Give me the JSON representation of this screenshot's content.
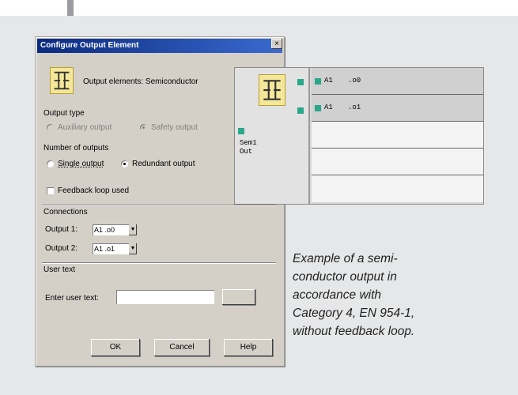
{
  "dialog": {
    "title": "Configure Output Element",
    "close_glyph": "×",
    "output_elements_label": "Output elements: Semiconductor",
    "output_type": {
      "heading": "Output type",
      "option1": "Auxiliary output",
      "option2": "Safety output",
      "selected": "option2"
    },
    "number_of_outputs": {
      "heading": "Number of outputs",
      "single": "Single output",
      "redundant": "Redundant output",
      "selected": "redundant"
    },
    "feedback_loop": {
      "label": "Feedback loop used",
      "checked": false
    },
    "connections": {
      "heading": "Connections",
      "output1_label": "Output 1:",
      "output1_value": "A1 .o0",
      "output2_label": "Output 2:",
      "output2_value": "A1 .o1"
    },
    "user_text": {
      "heading": "User text",
      "enter_label": "Enter user text:",
      "value": ""
    },
    "buttons": {
      "ok": "OK",
      "cancel": "Cancel",
      "help": "Help"
    }
  },
  "panel": {
    "element_label_line1": "Sem1",
    "element_label_line2": "Out",
    "rows": [
      {
        "addr": "A1",
        "port": ".o0"
      },
      {
        "addr": "A1",
        "port": ".o1"
      }
    ]
  },
  "caption": {
    "lines": [
      "Example of a semi-",
      "conductor output in",
      "accordance with",
      "Category 4, EN 954-1,",
      "without feedback loop."
    ]
  }
}
